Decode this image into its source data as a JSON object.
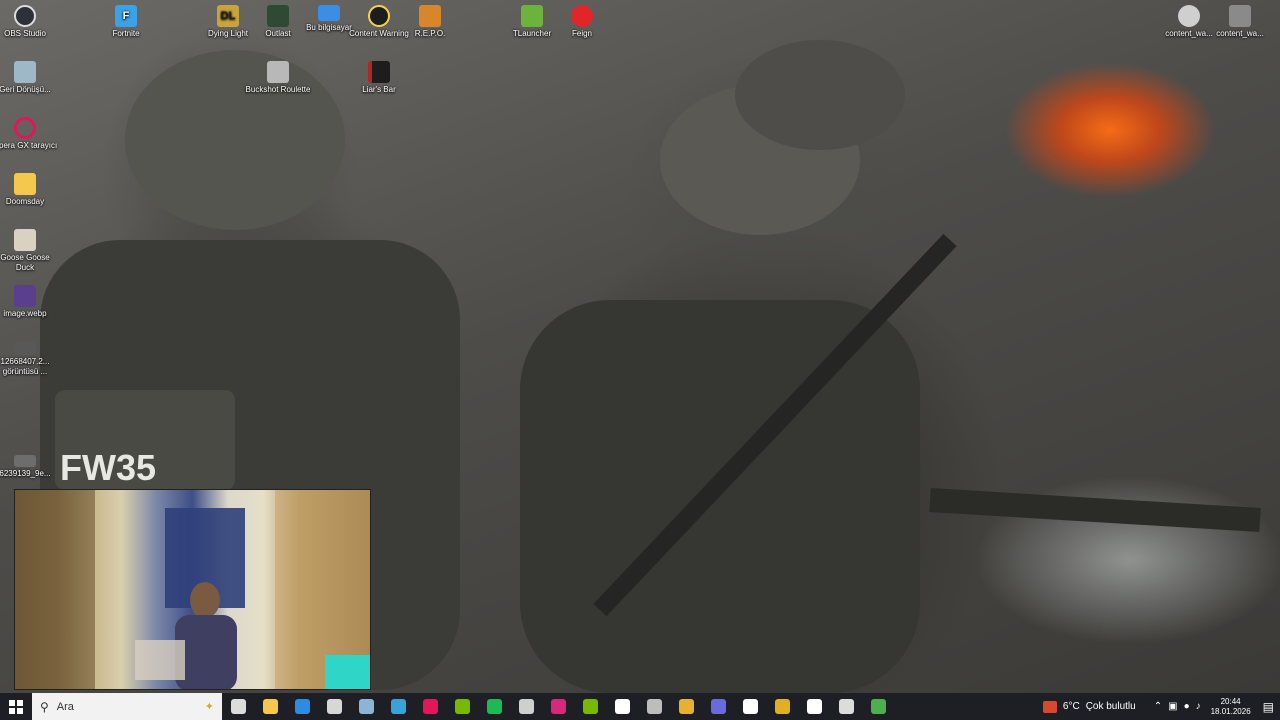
{
  "desktop": {
    "icons_left": [
      {
        "label": "OBS Studio",
        "icon": "obs-icon",
        "color": "#2d2f3a"
      },
      {
        "label": "Geri Dönüşü...",
        "icon": "recycle-bin-icon",
        "color": "#9fb8c8"
      },
      {
        "label": "Opera GX tarayıcı",
        "icon": "opera-gx-icon",
        "color": "#e3155b"
      },
      {
        "label": "Doomsday",
        "icon": "folder-icon",
        "color": "#f3c84d"
      },
      {
        "label": "Goose Goose Duck",
        "icon": "goose-goose-duck-icon",
        "color": "#d9d2c2"
      },
      {
        "label": "image.webp",
        "icon": "image-file-icon",
        "color": "#5b3f8f"
      },
      {
        "label": "12668407.2... görüntüsü ...",
        "icon": "image-thumbnail-icon",
        "color": "#585858"
      },
      {
        "label": "6239139_9e...",
        "icon": "image-thumbnail-icon",
        "color": "#6d6d6d"
      }
    ],
    "icons_top": [
      {
        "label": "Fortnite",
        "icon": "fortnite-icon",
        "color": "#3aa3e8"
      },
      {
        "label": "Dying Light",
        "icon": "dying-light-icon",
        "color": "#c9a43a"
      },
      {
        "label": "Outlast",
        "icon": "outlast-icon",
        "color": "#2f4a34"
      },
      {
        "label": "Bu bilgisayar",
        "icon": "this-pc-icon",
        "color": "#3a8ee6"
      },
      {
        "label": "Content Warning",
        "icon": "content-warning-icon",
        "color": "#f1d34a"
      },
      {
        "label": "R.E.P.O.",
        "icon": "repo-icon",
        "color": "#d8862c"
      },
      {
        "label": "TLauncher",
        "icon": "tlauncher-icon",
        "color": "#6bb33c"
      },
      {
        "label": "Feign",
        "icon": "feign-icon",
        "color": "#e0262a"
      },
      {
        "label": "Buckshot Roulette",
        "icon": "buckshot-roulette-icon",
        "color": "#b8b8b8"
      },
      {
        "label": "Liar's Bar",
        "icon": "liars-bar-icon",
        "color": "#b32525"
      }
    ],
    "icons_right": [
      {
        "label": "content_wa...",
        "icon": "content-file-icon",
        "color": "#cfcfcf"
      },
      {
        "label": "content_wa...",
        "icon": "content-file-icon",
        "color": "#8a8a8a"
      }
    ]
  },
  "taskbar": {
    "search_placeholder": "Ara",
    "apps": [
      {
        "name": "task-view-icon",
        "color": "#dcdcdc"
      },
      {
        "name": "file-explorer-icon",
        "color": "#f3c84d"
      },
      {
        "name": "mail-icon",
        "color": "#2c8be3"
      },
      {
        "name": "teams-icon",
        "color": "#d7d7d7"
      },
      {
        "name": "steam-icon",
        "color": "#8bb4d8"
      },
      {
        "name": "store-icon",
        "color": "#38a3d9"
      },
      {
        "name": "opera-gx-icon",
        "color": "#e3155b"
      },
      {
        "name": "nvidia-icon",
        "color": "#76b900"
      },
      {
        "name": "spotify-icon",
        "color": "#1db954"
      },
      {
        "name": "obs-icon",
        "color": "#cfcfcf"
      },
      {
        "name": "instagram-icon",
        "color": "#d6297a"
      },
      {
        "name": "geforce-icon",
        "color": "#76b900"
      },
      {
        "name": "discord-icon",
        "color": "#ffffff"
      },
      {
        "name": "microphone-app-icon",
        "color": "#bdbdbd"
      },
      {
        "name": "chrome-icon",
        "color": "#e8b030"
      },
      {
        "name": "audio-app-icon",
        "color": "#6a6adf"
      },
      {
        "name": "dc-icon",
        "color": "#ffffff"
      },
      {
        "name": "voicemod-icon",
        "color": "#e0b020"
      },
      {
        "name": "tiktok-icon",
        "color": "#ffffff"
      },
      {
        "name": "epic-games-icon",
        "color": "#dcdcdc"
      },
      {
        "name": "tlauncher-icon",
        "color": "#4caf50"
      }
    ],
    "weather_temp": "6°C",
    "weather_text": "Çok bulutlu",
    "time": "20:44",
    "date": "18.01.2026"
  }
}
